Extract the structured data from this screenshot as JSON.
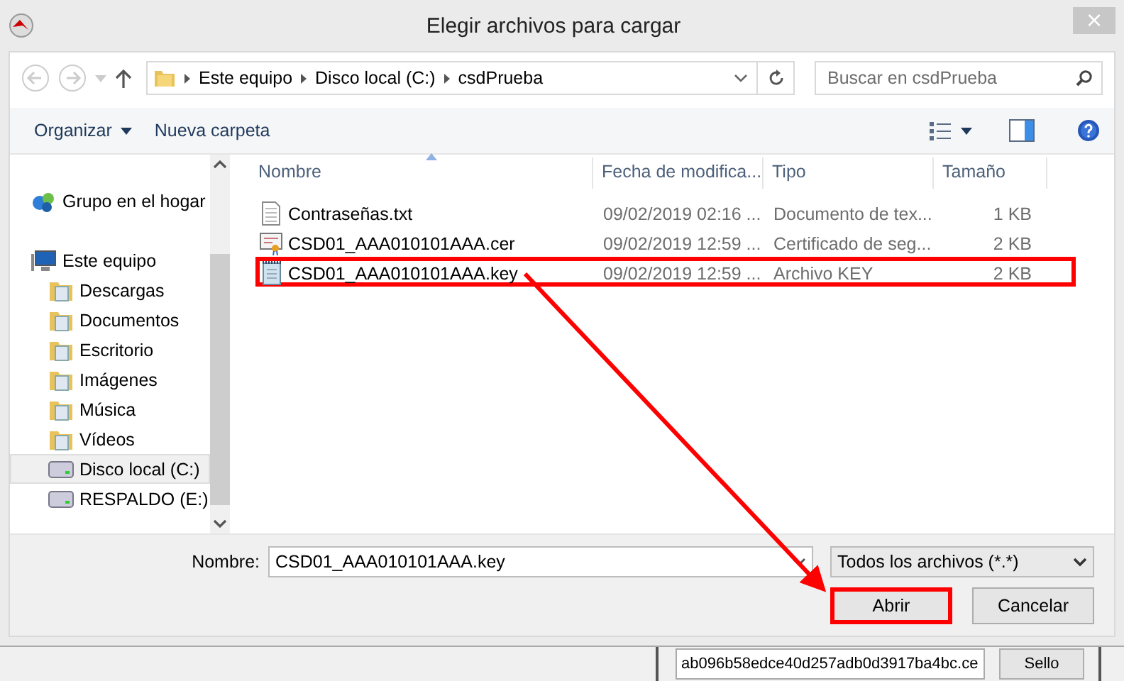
{
  "window": {
    "title": "Elegir archivos para cargar",
    "close": "×"
  },
  "breadcrumb": [
    "Este equipo",
    "Disco local (C:)",
    "csdPrueba"
  ],
  "search": {
    "placeholder": "Buscar en csdPrueba"
  },
  "toolbar": {
    "organize": "Organizar",
    "new_folder": "Nueva carpeta"
  },
  "sidebar": {
    "items": [
      {
        "label": "Grupo en el hogar",
        "kind": "homegroup",
        "selected": false
      },
      {
        "label": "Este equipo",
        "kind": "computer",
        "selected": false,
        "children": [
          {
            "label": "Descargas",
            "kind": "folder",
            "selected": false
          },
          {
            "label": "Documentos",
            "kind": "folder",
            "selected": false
          },
          {
            "label": "Escritorio",
            "kind": "folder",
            "selected": false
          },
          {
            "label": "Imágenes",
            "kind": "folder",
            "selected": false
          },
          {
            "label": "Música",
            "kind": "folder",
            "selected": false
          },
          {
            "label": "Vídeos",
            "kind": "folder",
            "selected": false
          },
          {
            "label": "Disco local (C:)",
            "kind": "drive",
            "selected": true
          },
          {
            "label": "RESPALDO (E:)",
            "kind": "drive",
            "selected": false
          }
        ]
      }
    ]
  },
  "table": {
    "columns": [
      "Nombre",
      "Fecha de modifica...",
      "Tipo",
      "Tamaño"
    ],
    "rows": [
      {
        "kind": "text",
        "name": "Contraseñas.txt",
        "date": "09/02/2019 02:16 ...",
        "type": "Documento de tex...",
        "size": "1 KB",
        "highlighted": false
      },
      {
        "kind": "cert",
        "name": "CSD01_AAA010101AAA.cer",
        "date": "09/02/2019 12:59 ...",
        "type": "Certificado de seg...",
        "size": "2 KB",
        "highlighted": false
      },
      {
        "kind": "key",
        "name": "CSD01_AAA010101AAA.key",
        "date": "09/02/2019 12:59 ...",
        "type": "Archivo KEY",
        "size": "2 KB",
        "highlighted": true
      }
    ]
  },
  "filename": {
    "label": "Nombre:",
    "value": "CSD01_AAA010101AAA.key"
  },
  "filter": {
    "value": "Todos los archivos (*.*)"
  },
  "buttons": [
    {
      "label": "Abrir",
      "highlighted": true
    },
    {
      "label": "Cancelar",
      "highlighted": false
    }
  ],
  "background_app": {
    "field": "ab096b58edce40d257adb0d3917ba4bc.ce",
    "button": "Sello"
  }
}
